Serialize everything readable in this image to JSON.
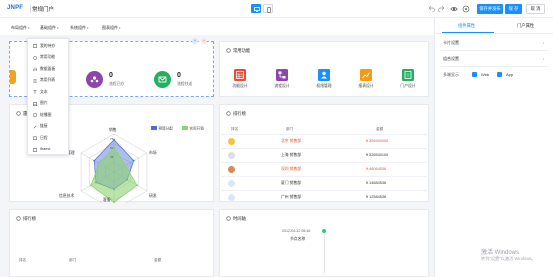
{
  "app": {
    "logo": "JNPF",
    "title": "常规门户"
  },
  "toolbar": {
    "save_publish_label": "保存并发布",
    "save_label": "保 存",
    "close_label": "取 消"
  },
  "controls": [
    {
      "label": "布局组件"
    },
    {
      "label": "基础组件"
    },
    {
      "label": "系统组件"
    },
    {
      "label": "图表组件"
    }
  ],
  "dropdown": {
    "items": [
      {
        "label": "我的待办"
      },
      {
        "label": "常用功能"
      },
      {
        "label": "数据面板"
      },
      {
        "label": "常用列表"
      },
      {
        "label": "文本"
      },
      {
        "label": "图片"
      },
      {
        "label": "轮播图"
      },
      {
        "label": "链接"
      },
      {
        "label": "日程"
      },
      {
        "label": "iframe"
      }
    ]
  },
  "todo_panel": {
    "stats": [
      {
        "value": "0",
        "label": "流程已办",
        "color": "#8e44ad"
      },
      {
        "value": "0",
        "label": "流程抄送",
        "color": "#27ae60"
      }
    ]
  },
  "common_functions": {
    "title": "常用功能",
    "items": [
      {
        "label": "功能设计",
        "color": "#e74c3c",
        "icon": "table-icon"
      },
      {
        "label": "流程设计",
        "color": "#8e44ad",
        "icon": "flow-icon"
      },
      {
        "label": "权限管理",
        "color": "#1890ff",
        "icon": "user-icon"
      },
      {
        "label": "报表设计",
        "color": "#f39c12",
        "icon": "chart-icon"
      },
      {
        "label": "门户设计",
        "color": "#27ae60",
        "icon": "portal-icon"
      }
    ]
  },
  "radar_panel": {
    "title": "雷",
    "chart_data": {
      "type": "radar",
      "indicators": [
        "销售",
        "市场",
        "研发",
        "客服",
        "信息技术",
        "管理"
      ],
      "ticks": [
        "75",
        "50",
        "25"
      ],
      "max": 100,
      "series": [
        {
          "name": "预算分配",
          "values": [
            85,
            60,
            40,
            45,
            55,
            60
          ],
          "color": "#4c6ed0"
        },
        {
          "name": "实际开销",
          "values": [
            65,
            35,
            70,
            80,
            70,
            45
          ],
          "color": "#8cd26e"
        }
      ],
      "legend": "top-right"
    }
  },
  "ranking_panel": {
    "title": "排行榜",
    "headers": [
      "排名",
      "部门",
      "金额"
    ],
    "rows": [
      {
        "name": "北京 销售部",
        "amount": "¥ 356940000",
        "medal": "#f5c242",
        "highlight": true
      },
      {
        "name": "上海 销售部",
        "amount": "¥ 526540100",
        "medal": "#dcdfe5",
        "highlight": false
      },
      {
        "name": "深圳 销售部",
        "amount": "¥ 46064536",
        "medal": "#d9895a",
        "highlight": true
      },
      {
        "name": "厦门 销售部",
        "amount": "¥ 14684536",
        "medal": "#dbe7f7",
        "highlight": false
      },
      {
        "name": "广州 销售部",
        "amount": "¥ 12584536",
        "medal": "#dbe7f7",
        "highlight": false
      }
    ]
  },
  "bottom_ranking": {
    "title": "排行榜",
    "headers": [
      "排名",
      "部门",
      "金额"
    ]
  },
  "timeline_panel": {
    "title": "时间轴",
    "time": "2012-04-12 06:46",
    "node": "节点名称"
  },
  "right_panel": {
    "tabs": [
      "组件属性",
      "门户属性"
    ],
    "sections": [
      "卡片设置",
      "组合设置"
    ],
    "field_label": "多端显示",
    "options": [
      "Web",
      "App"
    ]
  },
  "watermark": {
    "title": "激活 Windows",
    "subtitle": "转到\"设置\"以激活 Windows。"
  }
}
